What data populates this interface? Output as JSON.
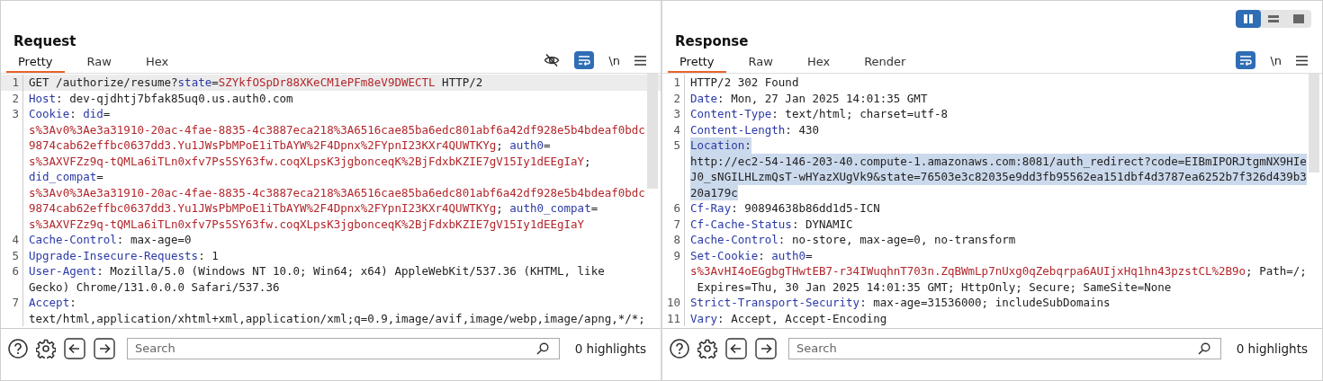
{
  "layout_toggle": [
    {
      "kind": "columns",
      "selected": true
    },
    {
      "kind": "rows",
      "selected": false
    },
    {
      "kind": "single",
      "selected": false
    }
  ],
  "panels": [
    {
      "title": "Request",
      "tabs": [
        {
          "label": "Pretty",
          "selected": true
        },
        {
          "label": "Raw",
          "selected": false
        },
        {
          "label": "Hex",
          "selected": false
        }
      ],
      "tools": [
        {
          "kind": "hide"
        },
        {
          "kind": "wrap",
          "on": true
        },
        {
          "kind": "newline",
          "label": "\\n"
        },
        {
          "kind": "menu"
        }
      ],
      "lines": [
        {
          "number": "1",
          "current": true,
          "selected": false,
          "rows": [
            {
              "parts": [
                {
                  "kind": "plain",
                  "text": "GET /authorize/resume?"
                },
                {
                  "kind": "key",
                  "text": "state"
                },
                {
                  "kind": "plain",
                  "text": "="
                },
                {
                  "kind": "value",
                  "text": "SZYkfOSpDr88XKeCM1ePFm8eV9DWECTL"
                },
                {
                  "kind": "plain",
                  "text": " HTTP/2"
                }
              ]
            }
          ]
        },
        {
          "number": "2",
          "current": false,
          "selected": false,
          "rows": [
            {
              "parts": [
                {
                  "kind": "key",
                  "text": "Host"
                },
                {
                  "kind": "plain",
                  "text": ": dev-qjdhtj7bfak85uq0.us.auth0.com"
                }
              ]
            }
          ]
        },
        {
          "number": "3",
          "current": false,
          "selected": false,
          "rows": [
            {
              "parts": [
                {
                  "kind": "key",
                  "text": "Cookie"
                },
                {
                  "kind": "plain",
                  "text": ": "
                },
                {
                  "kind": "key",
                  "text": "did"
                },
                {
                  "kind": "plain",
                  "text": "="
                }
              ]
            },
            {
              "parts": [
                {
                  "kind": "value",
                  "text": "s%3Av0%3Ae3a31910-20ac-4fae-8835-4c3887eca218%3A6516cae85ba6edc801abf6a42df928e5b4bdeaf0bdc"
                }
              ]
            },
            {
              "parts": [
                {
                  "kind": "value",
                  "text": "9874cab62effbc0637dd3.Yu1JWsPbMPoE1iTbAYW%2F4Dpnx%2FYpnI23KXr4QUWTKYg"
                },
                {
                  "kind": "plain",
                  "text": "; "
                },
                {
                  "kind": "key",
                  "text": "auth0"
                },
                {
                  "kind": "plain",
                  "text": "="
                }
              ]
            },
            {
              "parts": [
                {
                  "kind": "value",
                  "text": "s%3AXVFZz9q-tQMLa6iTLn0xfv7Ps5SY63fw.coqXLpsK3jgbonceqK%2BjFdxbKZIE7gV15Iy1dEEgIaY"
                },
                {
                  "kind": "plain",
                  "text": ";"
                }
              ]
            },
            {
              "parts": [
                {
                  "kind": "key",
                  "text": "did_compat"
                },
                {
                  "kind": "plain",
                  "text": "="
                }
              ]
            },
            {
              "parts": [
                {
                  "kind": "value",
                  "text": "s%3Av0%3Ae3a31910-20ac-4fae-8835-4c3887eca218%3A6516cae85ba6edc801abf6a42df928e5b4bdeaf0bdc"
                }
              ]
            },
            {
              "parts": [
                {
                  "kind": "value",
                  "text": "9874cab62effbc0637dd3.Yu1JWsPbMPoE1iTbAYW%2F4Dpnx%2FYpnI23KXr4QUWTKYg"
                },
                {
                  "kind": "plain",
                  "text": "; "
                },
                {
                  "kind": "key",
                  "text": "auth0_compat"
                },
                {
                  "kind": "plain",
                  "text": "="
                }
              ]
            },
            {
              "parts": [
                {
                  "kind": "value",
                  "text": "s%3AXVFZz9q-tQMLa6iTLn0xfv7Ps5SY63fw.coqXLpsK3jgbonceqK%2BjFdxbKZIE7gV15Iy1dEEgIaY"
                }
              ]
            }
          ]
        },
        {
          "number": "4",
          "current": false,
          "selected": false,
          "rows": [
            {
              "parts": [
                {
                  "kind": "key",
                  "text": "Cache-Control"
                },
                {
                  "kind": "plain",
                  "text": ": max-age=0"
                }
              ]
            }
          ]
        },
        {
          "number": "5",
          "current": false,
          "selected": false,
          "rows": [
            {
              "parts": [
                {
                  "kind": "key",
                  "text": "Upgrade-Insecure-Requests"
                },
                {
                  "kind": "plain",
                  "text": ": 1"
                }
              ]
            }
          ]
        },
        {
          "number": "6",
          "current": false,
          "selected": false,
          "rows": [
            {
              "parts": [
                {
                  "kind": "key",
                  "text": "User-Agent"
                },
                {
                  "kind": "plain",
                  "text": ": Mozilla/5.0 (Windows NT 10.0; Win64; x64) AppleWebKit/537.36 (KHTML, like"
                }
              ]
            },
            {
              "parts": [
                {
                  "kind": "plain",
                  "text": "Gecko) Chrome/131.0.0.0 Safari/537.36"
                }
              ]
            }
          ]
        },
        {
          "number": "7",
          "current": false,
          "selected": false,
          "rows": [
            {
              "parts": [
                {
                  "kind": "key",
                  "text": "Accept"
                },
                {
                  "kind": "plain",
                  "text": ":"
                }
              ]
            },
            {
              "parts": [
                {
                  "kind": "plain",
                  "text": "text/html,application/xhtml+xml,application/xml;q=0.9,image/avif,image/webp,image/apng,*/*;"
                }
              ]
            }
          ]
        }
      ],
      "search": {
        "placeholder": "Search"
      },
      "highlights": "0 highlights"
    },
    {
      "title": "Response",
      "tabs": [
        {
          "label": "Pretty",
          "selected": true
        },
        {
          "label": "Raw",
          "selected": false
        },
        {
          "label": "Hex",
          "selected": false
        },
        {
          "label": "Render",
          "selected": false
        }
      ],
      "tools": [
        {
          "kind": "wrap",
          "on": true
        },
        {
          "kind": "newline",
          "label": "\\n"
        },
        {
          "kind": "menu"
        }
      ],
      "lines": [
        {
          "number": "1",
          "current": false,
          "selected": false,
          "rows": [
            {
              "parts": [
                {
                  "kind": "plain",
                  "text": "HTTP/2 302 Found"
                }
              ]
            }
          ]
        },
        {
          "number": "2",
          "current": false,
          "selected": false,
          "rows": [
            {
              "parts": [
                {
                  "kind": "key",
                  "text": "Date"
                },
                {
                  "kind": "plain",
                  "text": ": Mon, 27 Jan 2025 14:01:35 GMT"
                }
              ]
            }
          ]
        },
        {
          "number": "3",
          "current": false,
          "selected": false,
          "rows": [
            {
              "parts": [
                {
                  "kind": "key",
                  "text": "Content-Type"
                },
                {
                  "kind": "plain",
                  "text": ": text/html; charset=utf-8"
                }
              ]
            }
          ]
        },
        {
          "number": "4",
          "current": false,
          "selected": false,
          "rows": [
            {
              "parts": [
                {
                  "kind": "key",
                  "text": "Content-Length"
                },
                {
                  "kind": "plain",
                  "text": ": 430"
                }
              ]
            }
          ]
        },
        {
          "number": "5",
          "current": false,
          "selected": true,
          "rows": [
            {
              "parts": [
                {
                  "kind": "key",
                  "text": "Location"
                },
                {
                  "kind": "plain",
                  "text": ":"
                }
              ]
            },
            {
              "parts": [
                {
                  "kind": "plain",
                  "text": "http://ec2-54-146-203-40.compute-1.amazonaws.com:8081/auth_redirect?code=EIBmIPORJtgmNX9HIe"
                }
              ]
            },
            {
              "parts": [
                {
                  "kind": "plain",
                  "text": "J0_sNGILHLzmQsT-wHYazXUgVk9&state=76503e3c82035e9dd3fb95562ea151dbf4d3787ea6252b7f326d439b3"
                }
              ]
            },
            {
              "parts": [
                {
                  "kind": "plain",
                  "text": "20a179c"
                }
              ]
            }
          ]
        },
        {
          "number": "6",
          "current": false,
          "selected": false,
          "rows": [
            {
              "parts": [
                {
                  "kind": "key",
                  "text": "Cf-Ray"
                },
                {
                  "kind": "plain",
                  "text": ": 90894638b86dd1d5-ICN"
                }
              ]
            }
          ]
        },
        {
          "number": "7",
          "current": false,
          "selected": false,
          "rows": [
            {
              "parts": [
                {
                  "kind": "key",
                  "text": "Cf-Cache-Status"
                },
                {
                  "kind": "plain",
                  "text": ": DYNAMIC"
                }
              ]
            }
          ]
        },
        {
          "number": "8",
          "current": false,
          "selected": false,
          "rows": [
            {
              "parts": [
                {
                  "kind": "key",
                  "text": "Cache-Control"
                },
                {
                  "kind": "plain",
                  "text": ": no-store, max-age=0, no-transform"
                }
              ]
            }
          ]
        },
        {
          "number": "9",
          "current": false,
          "selected": false,
          "rows": [
            {
              "parts": [
                {
                  "kind": "key",
                  "text": "Set-Cookie"
                },
                {
                  "kind": "plain",
                  "text": ": "
                },
                {
                  "kind": "key",
                  "text": "auth0"
                },
                {
                  "kind": "plain",
                  "text": "="
                }
              ]
            },
            {
              "parts": [
                {
                  "kind": "value",
                  "text": "s%3AvHI4oEGgbgTHwtEB7-r34IWuqhnT703n.ZqBWmLp7nUxg0qZebqrpa6AUIjxHq1hn43pzstCL%2B9o"
                },
                {
                  "kind": "plain",
                  "text": "; Path=/;"
                }
              ]
            },
            {
              "parts": [
                {
                  "kind": "plain",
                  "text": " Expires=Thu, 30 Jan 2025 14:01:35 GMT; HttpOnly; Secure; SameSite=None"
                }
              ]
            }
          ]
        },
        {
          "number": "10",
          "current": false,
          "selected": false,
          "rows": [
            {
              "parts": [
                {
                  "kind": "key",
                  "text": "Strict-Transport-Security"
                },
                {
                  "kind": "plain",
                  "text": ": max-age=31536000; includeSubDomains"
                }
              ]
            }
          ]
        },
        {
          "number": "11",
          "current": false,
          "selected": false,
          "rows": [
            {
              "parts": [
                {
                  "kind": "key",
                  "text": "Vary"
                },
                {
                  "kind": "plain",
                  "text": ": Accept, Accept-Encoding"
                }
              ]
            }
          ]
        }
      ],
      "search": {
        "placeholder": "Search"
      },
      "highlights": "0 highlights"
    }
  ]
}
